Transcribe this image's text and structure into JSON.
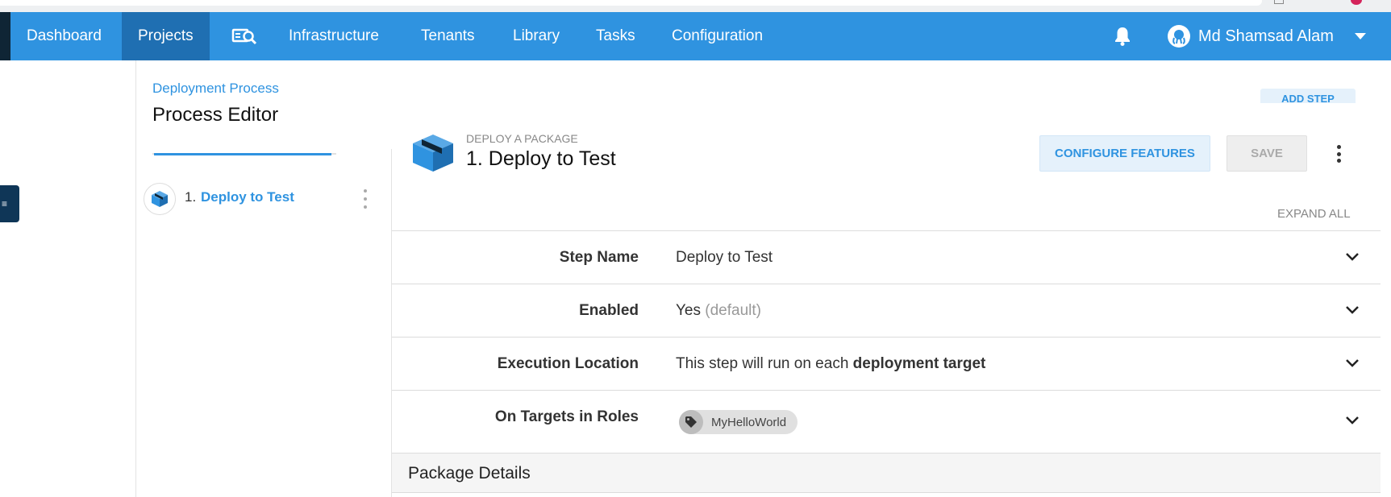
{
  "nav": {
    "items": [
      {
        "label": "Dashboard",
        "active": false
      },
      {
        "label": "Projects",
        "active": true
      },
      {
        "label": "Infrastructure",
        "active": false
      },
      {
        "label": "Tenants",
        "active": false
      },
      {
        "label": "Library",
        "active": false
      },
      {
        "label": "Tasks",
        "active": false
      },
      {
        "label": "Configuration",
        "active": false
      }
    ],
    "search_icon": "search-machine-icon",
    "bell_icon": "bell-icon",
    "user_name": "Md Shamsad Alam",
    "accent_color": "#2f93e0",
    "active_color": "#1f6fb2"
  },
  "page": {
    "breadcrumb": "Deployment Process",
    "title": "Process Editor",
    "add_step_label": "ADD STEP"
  },
  "sidebar": {
    "float_tab_icon": "menu-icon",
    "steps": [
      {
        "number": "1.",
        "label": "Deploy to Test",
        "icon": "package-icon"
      }
    ]
  },
  "step": {
    "type": "DEPLOY A PACKAGE",
    "heading": "1.  Deploy to Test",
    "configure_label": "CONFIGURE FEATURES",
    "save_label": "SAVE",
    "expand_all_label": "EXPAND ALL",
    "fields": {
      "step_name": {
        "label": "Step Name",
        "value": "Deploy to Test"
      },
      "enabled": {
        "label": "Enabled",
        "value": "Yes",
        "hint": "(default)"
      },
      "execution_location": {
        "label": "Execution Location",
        "value_prefix": "This step will run on each",
        "value_bold": "deployment target"
      },
      "roles": {
        "label": "On Targets in Roles",
        "chip": "MyHelloWorld",
        "chip_icon": "tag-icon"
      }
    },
    "section_title": "Package Details"
  }
}
